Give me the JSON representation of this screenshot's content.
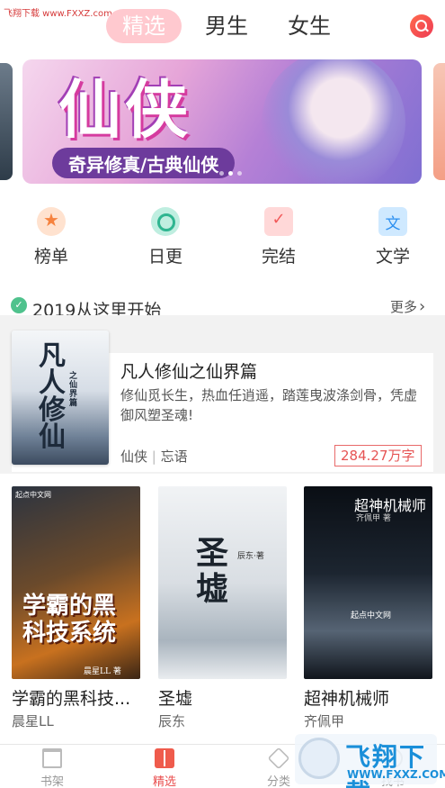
{
  "watermark": {
    "top_text": "飞翔下载 www.FXXZ.com",
    "name": "飞翔下载",
    "url": "WWW.FXXZ.COM"
  },
  "header": {
    "tabs": [
      {
        "label": "精选",
        "active": true
      },
      {
        "label": "男生",
        "active": false
      },
      {
        "label": "女生",
        "active": false
      }
    ],
    "search_icon": "search-icon"
  },
  "banner": {
    "title": "仙侠",
    "subtitle": "奇异修真/古典仙侠",
    "slide_count": 5,
    "active_slide": 2
  },
  "quicknav": [
    {
      "label": "榜单",
      "icon": "medal-icon"
    },
    {
      "label": "日更",
      "icon": "clock-icon"
    },
    {
      "label": "完结",
      "icon": "clipboard-check-icon"
    },
    {
      "label": "文学",
      "icon": "literature-icon"
    }
  ],
  "section": {
    "title": "2019从这里开始",
    "more": "更多"
  },
  "featured": {
    "title": "凡人修仙之仙界篇",
    "description": "修仙觅长生，热血任逍遥，踏莲曳波涤剑骨，凭虚御风塑圣魂!",
    "genre": "仙侠",
    "author": "忘语",
    "word_count": "284.27万字",
    "cover_text": "凡人修仙",
    "cover_sub": "之仙界篇"
  },
  "books": [
    {
      "title": "学霸的黑科技...",
      "author": "晨星LL",
      "cover_text": "学霸的黑科技系统",
      "cover_brand": "起点中文网",
      "cover_author": "晨星LL 著"
    },
    {
      "title": "圣墟",
      "author": "辰东",
      "cover_text": "圣墟",
      "cover_author": "辰东·著"
    },
    {
      "title": "超神机械师",
      "author": "齐佩甲",
      "cover_text": "超神机械师",
      "cover_author": "齐佩甲 著",
      "cover_brand": "起点中文网"
    }
  ],
  "tabbar": [
    {
      "label": "书架",
      "active": false
    },
    {
      "label": "精选",
      "active": true
    },
    {
      "label": "分类",
      "active": false
    },
    {
      "label": "找书",
      "active": false
    }
  ]
}
